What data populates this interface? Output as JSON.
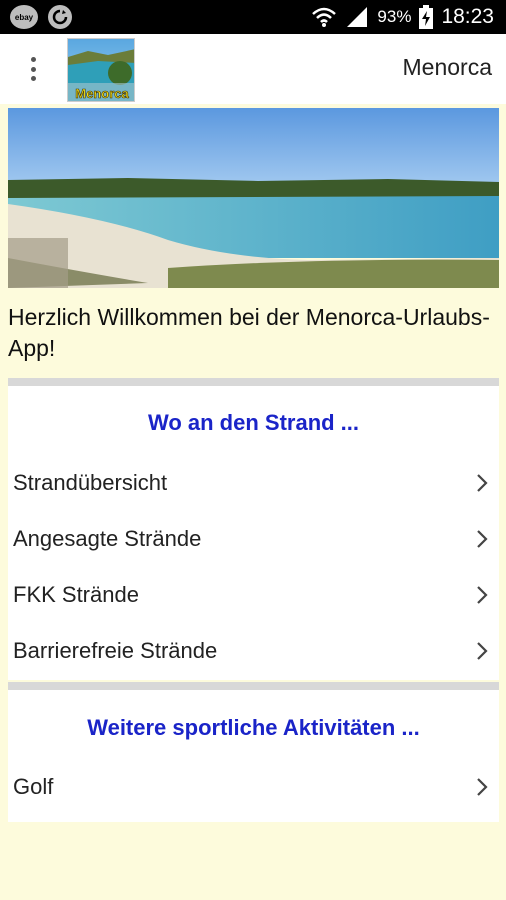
{
  "status_bar": {
    "ebay_label": "ebay",
    "battery": "93%",
    "time": "18:23"
  },
  "app_bar": {
    "menu_icon": "overflow-menu-icon",
    "logo_text": "Menorca",
    "title": "Menorca"
  },
  "welcome_text": "Herzlich Willkommen bei der Menorca-Urlaubs-App!",
  "sections": [
    {
      "heading": "Wo an den Strand ...",
      "items": [
        {
          "label": "Strandübersicht"
        },
        {
          "label": "Angesagte Strände"
        },
        {
          "label": "FKK Strände"
        },
        {
          "label": "Barrierefreie Strände"
        }
      ]
    },
    {
      "heading": "Weitere sportliche Aktivitäten ...",
      "items": [
        {
          "label": "Golf"
        }
      ]
    }
  ],
  "colors": {
    "background": "#fdfbdc",
    "heading": "#1a24c8"
  }
}
